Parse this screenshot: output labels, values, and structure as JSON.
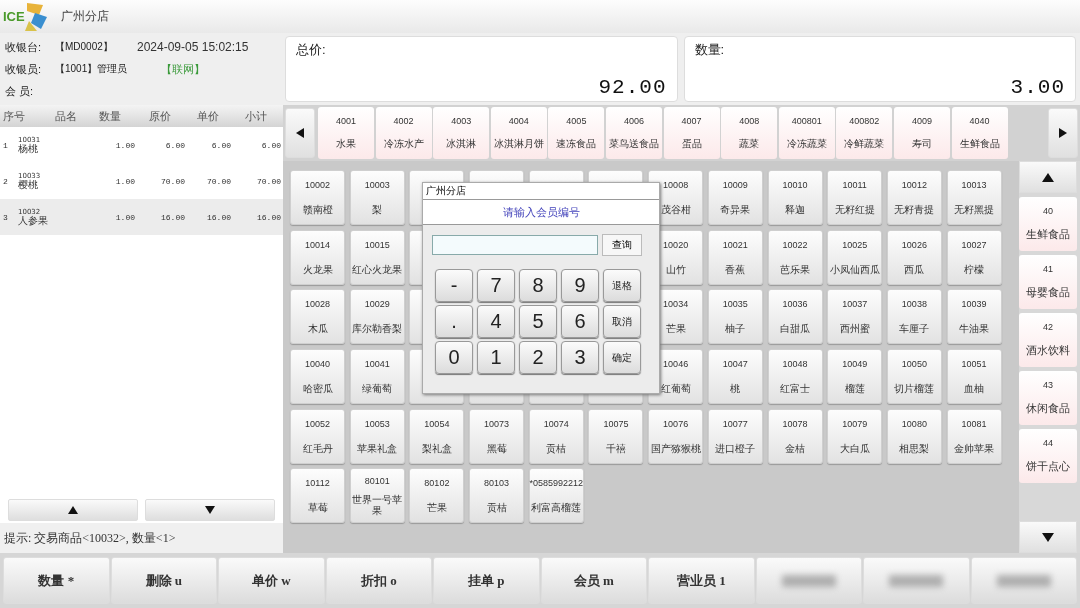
{
  "header": {
    "logo_text": "ICE",
    "store": "广州分店"
  },
  "info": {
    "register_label": "收银台:",
    "register": "【MD0002】",
    "datetime": "2024-09-05 15:02:15",
    "cashier_label": "收银员:",
    "cashier": "【1001】管理员",
    "network": "【联网】",
    "member_label": "会  员:"
  },
  "totals": [
    {
      "label": "总价:",
      "value": "92.00"
    },
    {
      "label": "数量:",
      "value": "3.00"
    }
  ],
  "table": {
    "columns": [
      "序号",
      "品名",
      "数量",
      "原价",
      "单价",
      "小计"
    ],
    "rows": [
      {
        "seq": "1",
        "code": "10031",
        "name": "杨桃",
        "qty": "1.00",
        "orig": "6.00",
        "price": "6.00",
        "subtotal": "6.00",
        "selected": false
      },
      {
        "seq": "2",
        "code": "10033",
        "name": "樱桃",
        "qty": "1.00",
        "orig": "70.00",
        "price": "70.00",
        "subtotal": "70.00",
        "selected": false
      },
      {
        "seq": "3",
        "code": "10032",
        "name": "人参果",
        "qty": "1.00",
        "orig": "16.00",
        "price": "16.00",
        "subtotal": "16.00",
        "selected": true
      }
    ]
  },
  "hint": "提示: 交易商品<10032>, 数量<1>",
  "categories": [
    {
      "code": "4001",
      "name": "水果"
    },
    {
      "code": "4002",
      "name": "冷冻水产"
    },
    {
      "code": "4003",
      "name": "冰淇淋"
    },
    {
      "code": "4004",
      "name": "冰淇淋月饼"
    },
    {
      "code": "4005",
      "name": "速冻食品"
    },
    {
      "code": "4006",
      "name": "菜鸟送食品"
    },
    {
      "code": "4007",
      "name": "蛋品"
    },
    {
      "code": "4008",
      "name": "蔬菜"
    },
    {
      "code": "400801",
      "name": "冷冻蔬菜"
    },
    {
      "code": "400802",
      "name": "冷鲜蔬菜"
    },
    {
      "code": "4009",
      "name": "寿司"
    },
    {
      "code": "4040",
      "name": "生鲜食品"
    }
  ],
  "side_categories": [
    {
      "code": "40",
      "name": "生鲜食品"
    },
    {
      "code": "41",
      "name": "母婴食品"
    },
    {
      "code": "42",
      "name": "酒水饮料"
    },
    {
      "code": "43",
      "name": "休闲食品"
    },
    {
      "code": "44",
      "name": "饼干点心"
    }
  ],
  "products": [
    {
      "kind": "item",
      "code": "10002",
      "name": "赣南橙"
    },
    {
      "kind": "item",
      "code": "10003",
      "name": "梨"
    },
    {
      "kind": "covered"
    },
    {
      "kind": "covered"
    },
    {
      "kind": "covered"
    },
    {
      "kind": "covered"
    },
    {
      "kind": "item",
      "code": "10008",
      "name": "茂谷柑"
    },
    {
      "kind": "item",
      "code": "10009",
      "name": "奇异果"
    },
    {
      "kind": "item",
      "code": "10010",
      "name": "释迦"
    },
    {
      "kind": "item",
      "code": "10011",
      "name": "无籽红提"
    },
    {
      "kind": "item",
      "code": "10012",
      "name": "无籽青提"
    },
    {
      "kind": "item",
      "code": "10013",
      "name": "无籽黑提"
    },
    {
      "kind": "item",
      "code": "10014",
      "name": "火龙果"
    },
    {
      "kind": "item",
      "code": "10015",
      "name": "红心火龙果"
    },
    {
      "kind": "covered"
    },
    {
      "kind": "hidden"
    },
    {
      "kind": "hidden"
    },
    {
      "kind": "hidden"
    },
    {
      "kind": "item",
      "code": "10020",
      "name": "山竹"
    },
    {
      "kind": "item",
      "code": "10021",
      "name": "香蕉"
    },
    {
      "kind": "item",
      "code": "10022",
      "name": "芭乐果"
    },
    {
      "kind": "item",
      "code": "10025",
      "name": "小凤仙西瓜"
    },
    {
      "kind": "item",
      "code": "10026",
      "name": "西瓜"
    },
    {
      "kind": "item",
      "code": "10027",
      "name": "柠檬"
    },
    {
      "kind": "item",
      "code": "10028",
      "name": "木瓜"
    },
    {
      "kind": "item",
      "code": "10029",
      "name": "库尔勒香梨"
    },
    {
      "kind": "covered"
    },
    {
      "kind": "hidden"
    },
    {
      "kind": "covered"
    },
    {
      "kind": "covered"
    },
    {
      "kind": "item",
      "code": "10034",
      "name": "芒果"
    },
    {
      "kind": "item",
      "code": "10035",
      "name": "柚子"
    },
    {
      "kind": "item",
      "code": "10036",
      "name": "白甜瓜"
    },
    {
      "kind": "item",
      "code": "10037",
      "name": "西州蜜"
    },
    {
      "kind": "item",
      "code": "10038",
      "name": "车厘子"
    },
    {
      "kind": "item",
      "code": "10039",
      "name": "牛油果"
    },
    {
      "kind": "item",
      "code": "10040",
      "name": "哈密瓜"
    },
    {
      "kind": "item",
      "code": "10041",
      "name": "绿葡萄"
    },
    {
      "kind": "covered"
    },
    {
      "kind": "covered"
    },
    {
      "kind": "covered"
    },
    {
      "kind": "covered"
    },
    {
      "kind": "item",
      "code": "10046",
      "name": "红葡萄"
    },
    {
      "kind": "item",
      "code": "10047",
      "name": "桃"
    },
    {
      "kind": "item",
      "code": "10048",
      "name": "红富士"
    },
    {
      "kind": "item",
      "code": "10049",
      "name": "榴莲"
    },
    {
      "kind": "item",
      "code": "10050",
      "name": "切片榴莲"
    },
    {
      "kind": "item",
      "code": "10051",
      "name": "血柚"
    },
    {
      "kind": "item",
      "code": "10052",
      "name": "红毛丹"
    },
    {
      "kind": "item",
      "code": "10053",
      "name": "苹果礼盒"
    },
    {
      "kind": "item",
      "code": "10054",
      "name": "梨礼盒"
    },
    {
      "kind": "item",
      "code": "10073",
      "name": "黑莓"
    },
    {
      "kind": "item",
      "code": "10074",
      "name": "贡桔"
    },
    {
      "kind": "item",
      "code": "10075",
      "name": "千禧"
    },
    {
      "kind": "item",
      "code": "10076",
      "name": "国产猕猴桃"
    },
    {
      "kind": "item",
      "code": "10077",
      "name": "进口橙子"
    },
    {
      "kind": "item",
      "code": "10078",
      "name": "金桔"
    },
    {
      "kind": "item",
      "code": "10079",
      "name": "大白瓜"
    },
    {
      "kind": "item",
      "code": "10080",
      "name": "相思梨"
    },
    {
      "kind": "item",
      "code": "10081",
      "name": "金帅苹果"
    },
    {
      "kind": "item",
      "code": "10112",
      "name": "草莓"
    },
    {
      "kind": "item",
      "code": "80101",
      "name": "世界一号苹果"
    },
    {
      "kind": "item",
      "code": "80102",
      "name": "芒果"
    },
    {
      "kind": "item",
      "code": "80103",
      "name": "贡桔"
    },
    {
      "kind": "item",
      "code": "*0585992212",
      "name": "利富高榴莲"
    }
  ],
  "dialog": {
    "title": "广州分店",
    "prompt": "请输入会员编号",
    "query_button": "查询",
    "keys": [
      {
        "label": "-",
        "kind": "digit"
      },
      {
        "label": "7",
        "kind": "digit"
      },
      {
        "label": "8",
        "kind": "digit"
      },
      {
        "label": "9",
        "kind": "digit"
      },
      {
        "label": "退格",
        "kind": "action"
      },
      {
        "label": ".",
        "kind": "digit"
      },
      {
        "label": "4",
        "kind": "digit"
      },
      {
        "label": "5",
        "kind": "digit"
      },
      {
        "label": "6",
        "kind": "digit"
      },
      {
        "label": "取消",
        "kind": "action"
      },
      {
        "label": "0",
        "kind": "digit"
      },
      {
        "label": "1",
        "kind": "digit"
      },
      {
        "label": "2",
        "kind": "digit"
      },
      {
        "label": "3",
        "kind": "digit"
      },
      {
        "label": "确定",
        "kind": "action"
      }
    ]
  },
  "function_keys": [
    {
      "kind": "key",
      "label": "数量 *"
    },
    {
      "kind": "key",
      "label": "删除 u"
    },
    {
      "kind": "key",
      "label": "单价 w"
    },
    {
      "kind": "key",
      "label": "折扣 o"
    },
    {
      "kind": "key",
      "label": "挂单 p"
    },
    {
      "kind": "key",
      "label": "会员 m"
    },
    {
      "kind": "key",
      "label": "营业员 1"
    },
    {
      "kind": "blurred"
    },
    {
      "kind": "blurred"
    },
    {
      "kind": "blurred"
    }
  ]
}
